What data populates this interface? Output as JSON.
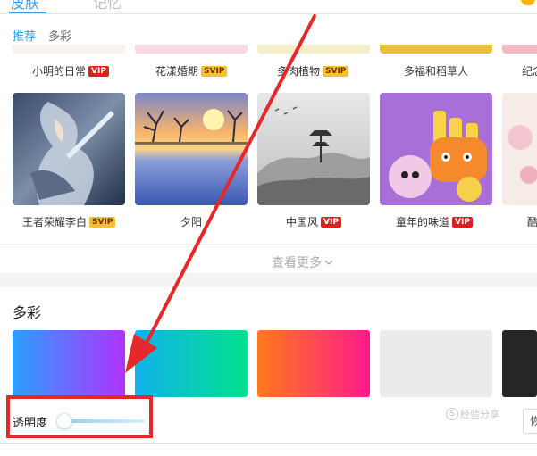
{
  "top_tabs": [
    {
      "label": "皮肤",
      "active": true
    },
    {
      "label": "记忆",
      "active": false
    }
  ],
  "sub_tabs": [
    {
      "label": "推荐",
      "active": true
    },
    {
      "label": "多彩",
      "active": false
    }
  ],
  "row1": [
    {
      "name": "小明的日常",
      "badge": "VIP"
    },
    {
      "name": "花漾婚期",
      "badge": "SVIP"
    },
    {
      "name": "多肉植物",
      "badge": "SVIP"
    },
    {
      "name": "多福和稻草人",
      "badge": ""
    },
    {
      "name": "纪念",
      "badge": ""
    }
  ],
  "row2": [
    {
      "name": "王者荣耀李白",
      "badge": "SVIP"
    },
    {
      "name": "夕阳",
      "badge": ""
    },
    {
      "name": "中国风",
      "badge": "VIP"
    },
    {
      "name": "童年的味道",
      "badge": "VIP"
    },
    {
      "name": "酷",
      "badge": ""
    }
  ],
  "more_label": "查看更多",
  "section_title": "多彩",
  "color_tiles": [
    {
      "name": "blue-purple",
      "from": "#2aa0ff",
      "to": "#b132ff"
    },
    {
      "name": "cyan-green",
      "from": "#12b1ec",
      "to": "#00e38c"
    },
    {
      "name": "orange-pink",
      "from": "#ff7a1a",
      "to": "#ff1a8c"
    },
    {
      "name": "light-gray",
      "from": "#ebebeb",
      "to": "#ebebeb"
    },
    {
      "name": "dark",
      "from": "#262626",
      "to": "#262626"
    }
  ],
  "opacity": {
    "label": "透明度",
    "value": 0.0
  },
  "watermark": "经验分享",
  "right_button_label": "恢",
  "colors": {
    "accent": "#2b9be8",
    "annotation": "#e5282a",
    "vip": "#e02020",
    "svip": "#f4c230"
  },
  "icons": {
    "more_chevron": "chevron-down-icon"
  }
}
